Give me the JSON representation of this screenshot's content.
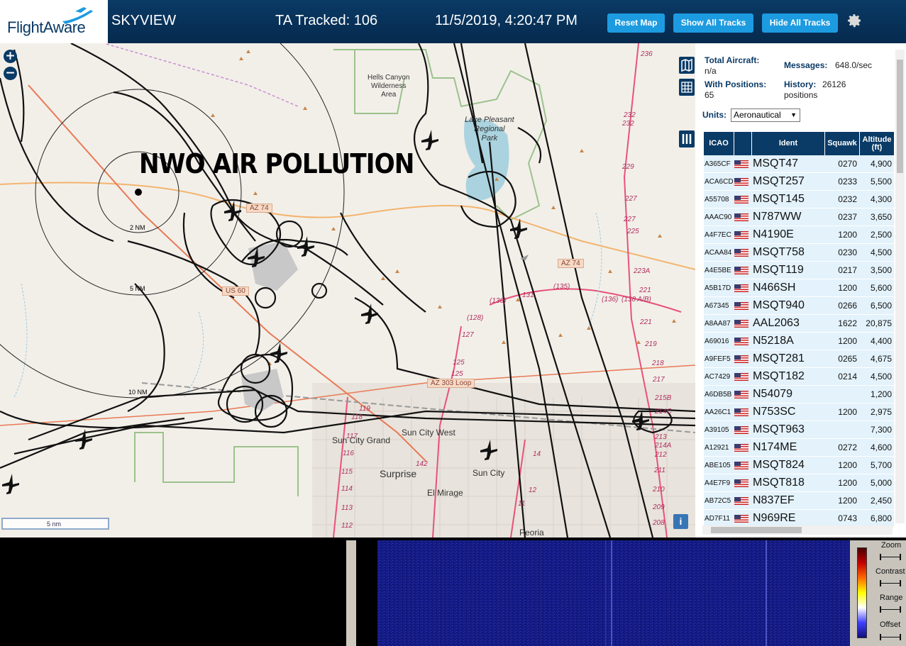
{
  "header": {
    "logo_text": "FlightAware",
    "app_name": "SKYVIEW",
    "tracked_label": "TA Tracked: 106",
    "datetime": "11/5/2019, 4:20:47 PM",
    "reset_map": "Reset Map",
    "show_all_tracks": "Show All Tracks",
    "hide_all_tracks": "Hide All Tracks"
  },
  "map": {
    "overlay_title": "NWO AIR POLLUTION",
    "zoom_in": "+",
    "zoom_out": "−",
    "range_rings": [
      "2 NM",
      "5 NM",
      "10 NM"
    ],
    "scale": "5 nm",
    "info": "i",
    "place_labels": {
      "hells_canyon": "Hells Canyon\nWilderness\nArea",
      "lake_pleasant": "Lake Pleasant\nRegional\nPark",
      "sun_city_west": "Sun City West",
      "sun_city_grand": "Sun City Grand",
      "surprise": "Surprise",
      "sun_city": "Sun City",
      "el_mirage": "El Mirage",
      "peoria": "Peoria"
    },
    "road_shields": [
      "AZ 74",
      "AZ 74",
      "US 60",
      "AZ 303 Loop"
    ],
    "highway_numbers": [
      "236",
      "232",
      "232",
      "229",
      "227",
      "227",
      "225",
      "223A",
      "221",
      "221",
      "219",
      "218",
      "217",
      "215B",
      "214C",
      "214A",
      "213",
      "212",
      "211",
      "210",
      "209",
      "208",
      "(136)",
      "(138 A/B)",
      "(135)",
      "131",
      "(130)",
      "(128)",
      "127",
      "125",
      "125",
      "119",
      "118",
      "117",
      "116",
      "115",
      "114",
      "113",
      "112",
      "142",
      "14",
      "12",
      "11"
    ]
  },
  "panel": {
    "total_aircraft_label": "Total Aircraft:",
    "total_aircraft_value": "n/a",
    "with_positions_label": "With Positions:",
    "with_positions_value": "65",
    "messages_label": "Messages:",
    "messages_value": "648.0/sec",
    "history_label": "History:",
    "history_value": "26126",
    "history_unit": "positions",
    "units_label": "Units:",
    "units_value": "Aeronautical",
    "columns": [
      "ICAO",
      "",
      "Ident",
      "Squawk",
      "Altitude (ft)"
    ],
    "rows": [
      {
        "icao": "A365CF",
        "ident": "MSQT47",
        "squawk": "0270",
        "altitude": "4,900"
      },
      {
        "icao": "ACA6CD",
        "ident": "MSQT257",
        "squawk": "0233",
        "altitude": "5,500"
      },
      {
        "icao": "A55708",
        "ident": "MSQT145",
        "squawk": "0232",
        "altitude": "4,300"
      },
      {
        "icao": "AAAC90",
        "ident": "N787WW",
        "squawk": "0237",
        "altitude": "3,650"
      },
      {
        "icao": "A4F7EC",
        "ident": "N4190E",
        "squawk": "1200",
        "altitude": "2,500"
      },
      {
        "icao": "ACAA84",
        "ident": "MSQT758",
        "squawk": "0230",
        "altitude": "4,500"
      },
      {
        "icao": "A4E5BE",
        "ident": "MSQT119",
        "squawk": "0217",
        "altitude": "3,500"
      },
      {
        "icao": "A5B17D",
        "ident": "N466SH",
        "squawk": "1200",
        "altitude": "5,600"
      },
      {
        "icao": "A67345",
        "ident": "MSQT940",
        "squawk": "0266",
        "altitude": "6,500"
      },
      {
        "icao": "A8AA87",
        "ident": "AAL2063",
        "squawk": "1622",
        "altitude": "20,875"
      },
      {
        "icao": "A69016",
        "ident": "N5218A",
        "squawk": "1200",
        "altitude": "4,400"
      },
      {
        "icao": "A9FEF5",
        "ident": "MSQT281",
        "squawk": "0265",
        "altitude": "4,675"
      },
      {
        "icao": "AC7429",
        "ident": "MSQT182",
        "squawk": "0214",
        "altitude": "4,500"
      },
      {
        "icao": "A6DB5B",
        "ident": "N54079",
        "squawk": "",
        "altitude": "1,200"
      },
      {
        "icao": "AA26C1",
        "ident": "N753SC",
        "squawk": "1200",
        "altitude": "2,975"
      },
      {
        "icao": "A39105",
        "ident": "MSQT963",
        "squawk": "",
        "altitude": "7,300"
      },
      {
        "icao": "A12921",
        "ident": "N174ME",
        "squawk": "0272",
        "altitude": "4,600"
      },
      {
        "icao": "ABE105",
        "ident": "MSQT824",
        "squawk": "1200",
        "altitude": "5,700"
      },
      {
        "icao": "A4E7F9",
        "ident": "MSQT818",
        "squawk": "1200",
        "altitude": "5,000"
      },
      {
        "icao": "AB72C5",
        "ident": "N837EF",
        "squawk": "1200",
        "altitude": "2,450"
      },
      {
        "icao": "AD7F11",
        "ident": "N969RE",
        "squawk": "0743",
        "altitude": "6,800"
      }
    ]
  },
  "waterfall": {
    "zoom_label": "Zoom",
    "contrast_label": "Contrast",
    "range_label": "Range",
    "offset_label": "Offset"
  },
  "colors": {
    "header_bg": "#0a3a66",
    "button_bg": "#1d9be0",
    "row_bg": "#e3f2fb",
    "map_bg": "#f2efe9",
    "track": "#000000",
    "waterfall": "#1a1a8c"
  }
}
